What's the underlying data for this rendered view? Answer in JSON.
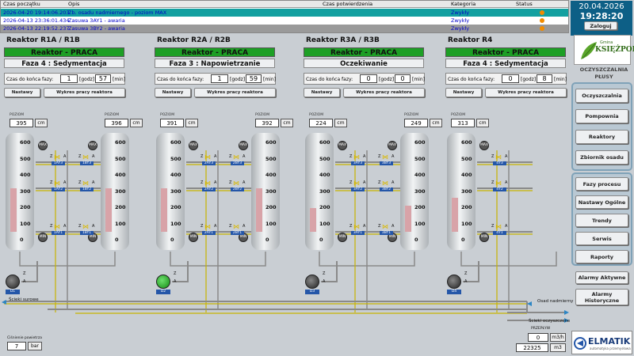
{
  "alarms": {
    "headers": {
      "start": "Czas początku",
      "desc": "Opis",
      "confirm": "Czas potwierdzenia",
      "cat": "Kategoria",
      "status": "Status"
    },
    "rows": [
      {
        "time": "2026-04-20 19:14:06.203",
        "desc": "Zb. osadu nadmiernego - poziom MAX",
        "cat": "Zwykły",
        "bg": "#13a0a0",
        "fg": "#0000c8"
      },
      {
        "time": "2026-04-13 23:36:01.434",
        "desc": "Zasuwa 3AY1 - awaria",
        "cat": "Zwykły",
        "bg": "#ffffff",
        "fg": "#0000c8"
      },
      {
        "time": "2026-04-13 22:19:52.237",
        "desc": "Zasuwa 3BY2 - awaria",
        "cat": "Zwykły",
        "bg": "#9a9a9a",
        "fg": "#0000c8"
      }
    ]
  },
  "header": {
    "date": "20.04.2026",
    "time": "19:28:20",
    "login": "Zaloguj"
  },
  "logo": {
    "small": "Gmina",
    "name": "KSIĘŻPOL",
    "caption1": "OCZYSZCZALNIA",
    "caption2": "PŁUSY"
  },
  "nav1": [
    "Oczyszczalnia",
    "Pompownia",
    "Reaktory",
    "Zbiornik osadu"
  ],
  "nav2": [
    "Fazy procesu",
    "Nastawy Ogólne",
    "Trendy",
    "Serwis",
    "Raporty"
  ],
  "nav3": [
    "Alarmy Aktywne",
    "Alarmy Historyczne"
  ],
  "brand": "ELMATIK",
  "brand_sub": "automatyka przemysłowa",
  "common": {
    "czas_label": "Czas do końca fazy:",
    "godz": "[godz]",
    "min": "[min]",
    "nastawy": "Nastawy",
    "wykres": "Wykres pracy reaktora",
    "poziom": "POZIOM",
    "cm": "cm",
    "max": "MAX",
    "min_btn": "MIN",
    "z": "Z",
    "a": "A"
  },
  "reactors": [
    {
      "title": "Reaktor R1A / R1B",
      "state": "Reaktor - PRACA",
      "phase": "Faza 4 : Sedymentacja",
      "hours": "1",
      "mins": "57",
      "levelA": "395",
      "levelB": "396",
      "fillA": 0.55,
      "fillB": 0.55,
      "valvesA": [
        "1AY3",
        "1AY2",
        "1AY1"
      ],
      "valvesB": [
        "1BY3",
        "1BY2",
        "1BY1"
      ],
      "pump": "D1",
      "pumpOn": false
    },
    {
      "title": "Reaktor R2A / R2B",
      "state": "Reaktor - PRACA",
      "phase": "Faza 3 : Napowietrzanie",
      "hours": "1",
      "mins": "59",
      "levelA": "391",
      "levelB": "392",
      "fillA": 0.55,
      "fillB": 0.55,
      "valvesA": [
        "2AY3",
        "2AY2",
        "2AY1"
      ],
      "valvesB": [
        "2BY3",
        "2BY2",
        "2BY1"
      ],
      "pump": "D2",
      "pumpOn": true
    },
    {
      "title": "Reaktor R3A / R3B",
      "state": "Reaktor - PRACA",
      "phase": "Oczekiwanie",
      "hours": "0",
      "mins": "0",
      "levelA": "224",
      "levelB": "249",
      "fillA": 0.3,
      "fillB": 0.33,
      "valvesA": [
        "3AY3",
        "3AY2",
        "3AY1"
      ],
      "valvesB": [
        "3BY3",
        "3BY2",
        "3BY1"
      ],
      "pump": "D3",
      "pumpOn": false
    },
    {
      "title": "Reaktor R4",
      "state": "Reaktor - PRACA",
      "phase": "Faza 4 : Sedymentacja",
      "hours": "0",
      "mins": "8",
      "levelA": "313",
      "fillA": 0.43,
      "valvesA": [
        "4Y3",
        "4Y2",
        "4Y1"
      ],
      "pump": "D4",
      "pumpOn": false
    }
  ],
  "scale": [
    "600",
    "500",
    "400",
    "300",
    "200",
    "100",
    "0"
  ],
  "bottom": {
    "surowe": "Ścieki surowe",
    "nadmierny": "Osad nadmierny",
    "oczyszczone": "Ścieki oczyszczone",
    "przeplyw": "PRZEPŁYW",
    "flow": "0",
    "flow_unit": "m3/h",
    "total": "22325",
    "total_unit": "m3",
    "cisnienie": "Ciśnienie powietrza",
    "pressure": "7",
    "pressure_unit": "bar"
  },
  "colors": {
    "praca": "#1d9f25",
    "valve": "#2456a8",
    "pipe": "#8a8a8a",
    "pipeY": "#c8b400"
  }
}
